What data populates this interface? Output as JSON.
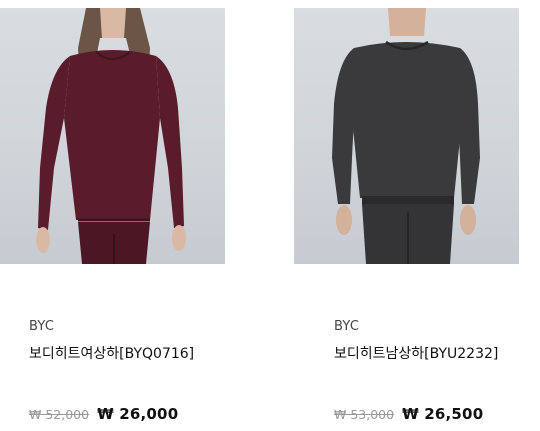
{
  "products": [
    {
      "brand": "BYC",
      "title": "보디히트여상하[BYQ0716]",
      "original_price": "₩ 52,000",
      "sale_price": "₩ 26,000",
      "garment_color": "#5a1b2b"
    },
    {
      "brand": "BYC",
      "title": "보디히트남상하[BYU2232]",
      "original_price": "₩ 53,000",
      "sale_price": "₩ 26,500",
      "garment_color": "#3a3a3c"
    }
  ]
}
